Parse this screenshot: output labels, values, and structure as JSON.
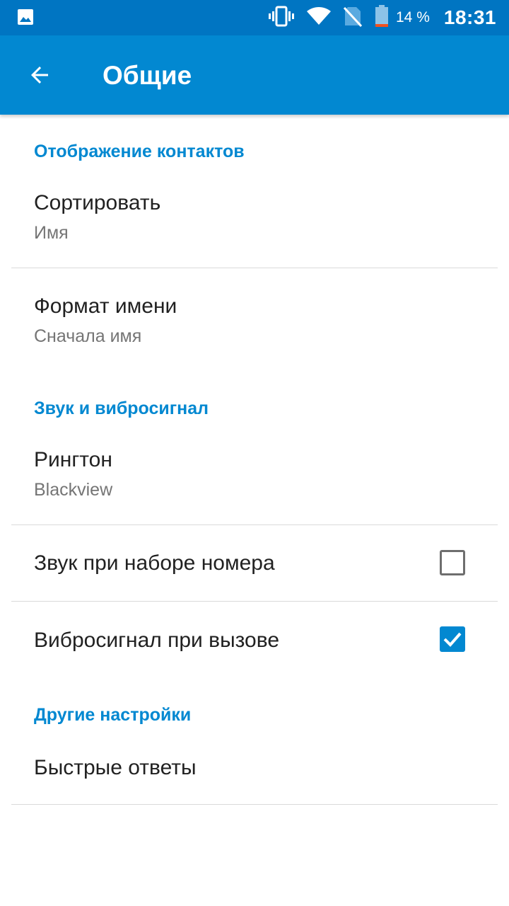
{
  "status_bar": {
    "icons": [
      "image-icon",
      "vibrate-icon",
      "wifi-icon",
      "no-sim-icon",
      "battery-icon"
    ],
    "battery_percent": "14 %",
    "time": "18:31",
    "battery_level": 0.14
  },
  "app_bar": {
    "title": "Общие",
    "back_icon": "arrow-back-icon",
    "color": "#0288D1"
  },
  "sections": [
    {
      "header": "Отображение контактов"
    },
    {
      "header": "Звук и вибросигнал"
    },
    {
      "header": "Другие настройки"
    }
  ],
  "prefs": {
    "sort": {
      "title": "Сортировать",
      "summary": "Имя"
    },
    "name_format": {
      "title": "Формат имени",
      "summary": "Сначала имя"
    },
    "ringtone": {
      "title": "Рингтон",
      "summary": "Blackview"
    },
    "dial_sound": {
      "title": "Звук при наборе номера",
      "checked": false
    },
    "call_vibrate": {
      "title": "Вибросигнал при вызове",
      "checked": true
    },
    "quick_responses": {
      "title": "Быстрые ответы"
    }
  },
  "colors": {
    "accent": "#0288D1",
    "status_bar": "#0075C2",
    "primary_text": "#212121",
    "secondary_text": "#757575"
  }
}
